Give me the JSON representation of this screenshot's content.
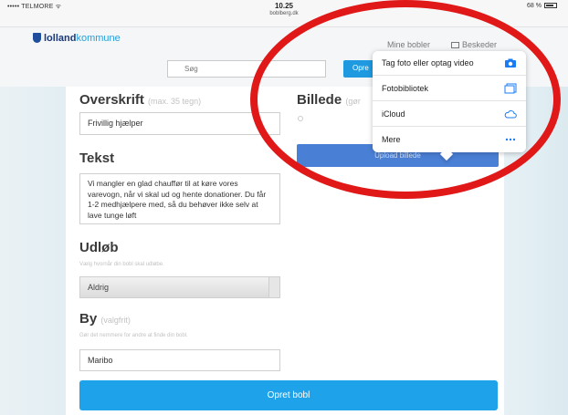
{
  "statusbar": {
    "carrier": "••••• TELMORE ᯤ",
    "time": "10.25",
    "url": "boblberg.dk",
    "battery": "68 %"
  },
  "header": {
    "logo_a": "lolland",
    "logo_b": "kommune",
    "nav_mine": "Mine bobler",
    "nav_messages": "Beskeder",
    "search_placeholder": "Søg",
    "opret_label": "Opre"
  },
  "form": {
    "overskrift_label": "Overskrift",
    "overskrift_hint": "(max. 35 tegn)",
    "overskrift_value": "Frivillig hjælper",
    "billede_label": "Billede",
    "billede_hint": "(gør",
    "tekst_label": "Tekst",
    "tekst_value": "Vi mangler en glad chauffør til at køre vores varevogn, når vi skal ud og hente donationer. Du får 1-2 medhjælpere med, så du behøver ikke selv at lave tunge løft",
    "udlob_label": "Udløb",
    "udlob_hint": "Vælg hvornår din bobl skal udløbe.",
    "udlob_value": "Aldrig",
    "by_label": "By",
    "by_hint": "(valgfrit)",
    "by_sub": "Gør det nemmere for andre at finde din bobl.",
    "by_value": "Maribo",
    "upload_label": "Upload billede",
    "submit_label": "Opret bobl"
  },
  "popover": {
    "items": [
      {
        "label": "Tag foto eller optag video",
        "icon": "camera-icon"
      },
      {
        "label": "Fotobibliotek",
        "icon": "photo-library-icon"
      },
      {
        "label": "iCloud",
        "icon": "cloud-icon"
      },
      {
        "label": "Mere",
        "icon": "more-dots-icon"
      }
    ]
  },
  "colors": {
    "accent": "#1ea3ea",
    "upload": "#4a7fd6",
    "ios_blue": "#1a7cf4",
    "annotation": "#e01818"
  }
}
